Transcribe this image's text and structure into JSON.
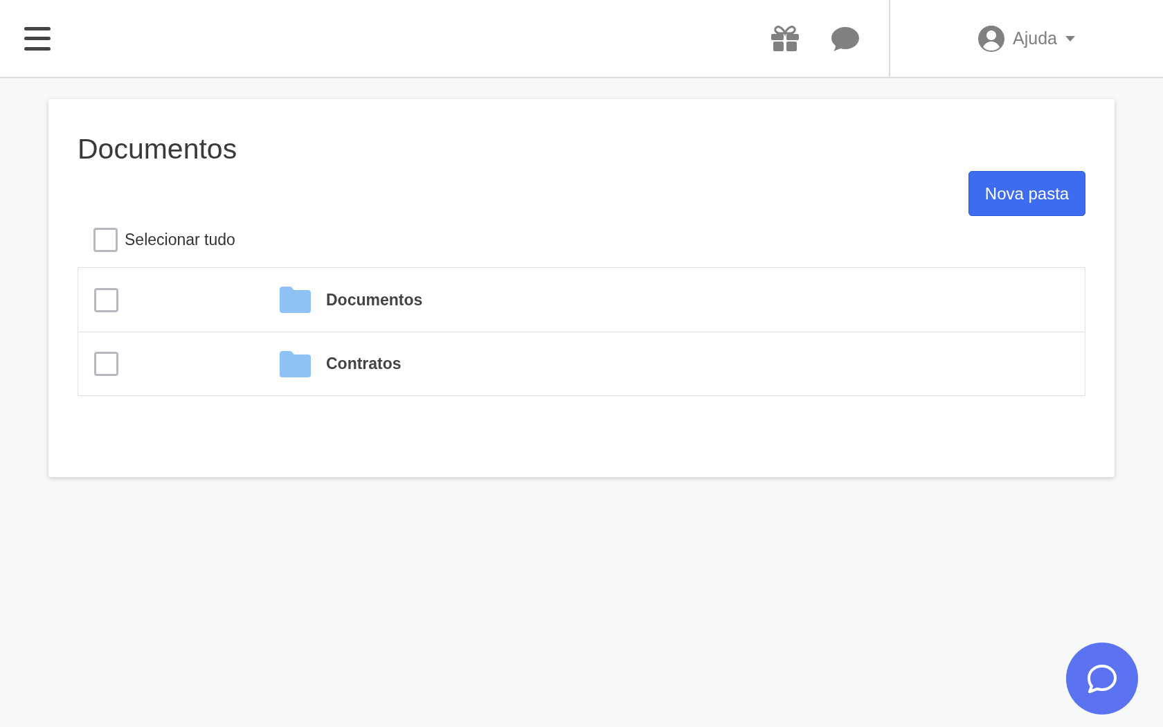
{
  "header": {
    "user_menu": {
      "label": "Ajuda"
    }
  },
  "page": {
    "title": "Documentos",
    "new_folder_button": "Nova pasta",
    "select_all": {
      "label": "Selecionar tudo",
      "checked": false
    },
    "folders": [
      {
        "name": "Documentos",
        "checked": false
      },
      {
        "name": "Contratos",
        "checked": false
      }
    ]
  }
}
